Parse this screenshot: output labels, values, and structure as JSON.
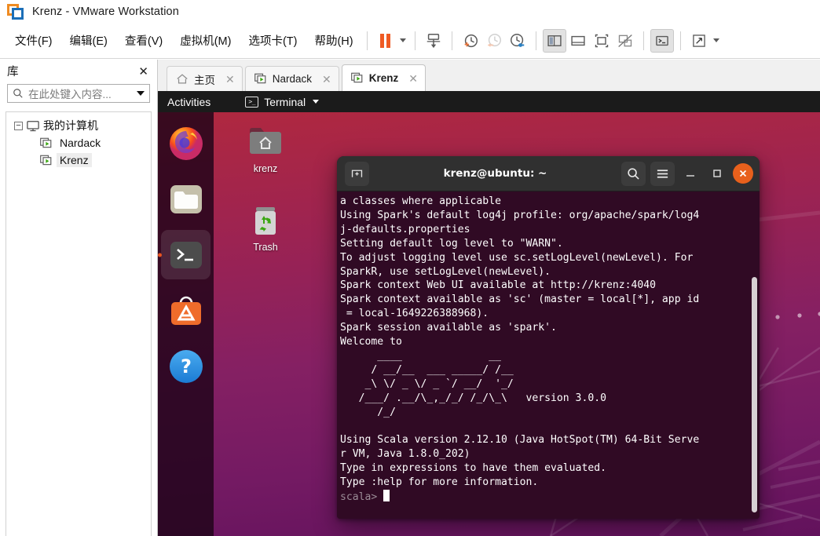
{
  "window": {
    "title": "Krenz - VMware Workstation",
    "logo_icon": "vmware-logo-icon"
  },
  "menubar": {
    "items": [
      {
        "label": "文件(F)",
        "name": "menu-file"
      },
      {
        "label": "编辑(E)",
        "name": "menu-edit"
      },
      {
        "label": "查看(V)",
        "name": "menu-view"
      },
      {
        "label": "虚拟机(M)",
        "name": "menu-vm"
      },
      {
        "label": "选项卡(T)",
        "name": "menu-tabs"
      },
      {
        "label": "帮助(H)",
        "name": "menu-help"
      }
    ],
    "toolbar": [
      {
        "icon": "pause-icon",
        "name": "power-pause-button"
      },
      {
        "icon": "chevron-down-icon",
        "name": "power-dropdown"
      },
      {
        "icon": "send-to-icon",
        "name": "manage-vm-button"
      },
      {
        "icon": "snapshot-take-icon",
        "name": "take-snapshot-button"
      },
      {
        "icon": "snapshot-revert-icon",
        "name": "revert-snapshot-button"
      },
      {
        "icon": "snapshot-manager-icon",
        "name": "snapshot-manager-button"
      },
      {
        "icon": "sidebar-toggle-icon",
        "name": "show-library-button"
      },
      {
        "icon": "console-view-icon",
        "name": "show-console-view-button"
      },
      {
        "icon": "fullscreen-icon",
        "name": "enter-fullscreen-button"
      },
      {
        "icon": "unity-mode-icon",
        "name": "unity-mode-button"
      },
      {
        "icon": "terminal-icon",
        "name": "show-thumbnail-bar-button"
      },
      {
        "icon": "expand-arrows-icon",
        "name": "stretch-guest-button"
      },
      {
        "icon": "chevron-down-icon",
        "name": "stretch-dropdown"
      }
    ]
  },
  "tabs": [
    {
      "label": "主页",
      "icon": "home-icon",
      "active": false,
      "name": "tab-home"
    },
    {
      "label": "Nardack",
      "icon": "vm-icon",
      "active": false,
      "name": "tab-nardack"
    },
    {
      "label": "Krenz",
      "icon": "vm-icon",
      "active": true,
      "name": "tab-krenz"
    }
  ],
  "sidebar": {
    "title": "库",
    "close_icon": "close-icon",
    "search": {
      "placeholder": "在此处键入内容...",
      "value": "",
      "icon": "search-icon",
      "dropdown_icon": "chevron-down-icon"
    },
    "tree": {
      "root": {
        "label": "我的计算机",
        "icon": "computer-icon",
        "expander": "−"
      },
      "children": [
        {
          "label": "Nardack",
          "icon": "vm-icon",
          "selected": false
        },
        {
          "label": "Krenz",
          "icon": "vm-icon",
          "selected": true
        }
      ]
    }
  },
  "guest": {
    "topbar": {
      "activities": "Activities",
      "app_icon": "terminal-icon",
      "app_name": "Terminal",
      "caret_icon": "chevron-down-icon"
    },
    "dock": [
      {
        "name": "dock-item-firefox",
        "icon": "firefox-icon",
        "running": false
      },
      {
        "name": "dock-item-files",
        "icon": "files-folder-icon",
        "running": false
      },
      {
        "name": "dock-item-terminal",
        "icon": "terminal-icon",
        "running": true
      },
      {
        "name": "dock-item-ubuntu-software",
        "icon": "ubuntu-software-icon",
        "running": false
      },
      {
        "name": "dock-item-help",
        "icon": "help-icon",
        "running": false
      }
    ],
    "desktop_icons": [
      {
        "label": "krenz",
        "icon": "home-folder-icon",
        "name": "desktop-icon-krenz"
      },
      {
        "label": "Trash",
        "icon": "trash-icon",
        "name": "desktop-icon-trash"
      }
    ]
  },
  "terminal": {
    "titlebar": {
      "new_tab_icon": "new-tab-icon",
      "title": "krenz@ubuntu: ~",
      "search_icon": "search-icon",
      "menu_icon": "hamburger-menu-icon",
      "minimize_icon": "minimize-icon",
      "maximize_icon": "maximize-icon",
      "close_icon": "close-icon"
    },
    "lines": [
      "a classes where applicable",
      "Using Spark's default log4j profile: org/apache/spark/log4",
      "j-defaults.properties",
      "Setting default log level to \"WARN\".",
      "To adjust logging level use sc.setLogLevel(newLevel). For",
      "SparkR, use setLogLevel(newLevel).",
      "Spark context Web UI available at http://krenz:4040",
      "Spark context available as 'sc' (master = local[*], app id",
      " = local-1649226388968).",
      "Spark session available as 'spark'.",
      "Welcome to",
      "      ____              __",
      "     / __/__  ___ _____/ /__",
      "    _\\ \\/ _ \\/ _ `/ __/  '_/",
      "   /___/ .__/\\_,_/_/ /_/\\_\\   version 3.0.0",
      "      /_/",
      "",
      "Using Scala version 2.12.10 (Java HotSpot(TM) 64-Bit Serve",
      "r VM, Java 1.8.0_202)",
      "Type in expressions to have them evaluated.",
      "Type :help for more information.",
      ""
    ],
    "prompt": "scala> ",
    "input_value": "",
    "scrollbar": "vertical-scrollbar"
  },
  "colors": {
    "vmware_orange": "#ef8b22",
    "vmware_blue": "#1c6fb8",
    "pause_orange": "#ef5a23",
    "terminal_bg": "#300a24",
    "ubuntu_orange": "#e95420",
    "titlebar_dark": "#303030"
  }
}
